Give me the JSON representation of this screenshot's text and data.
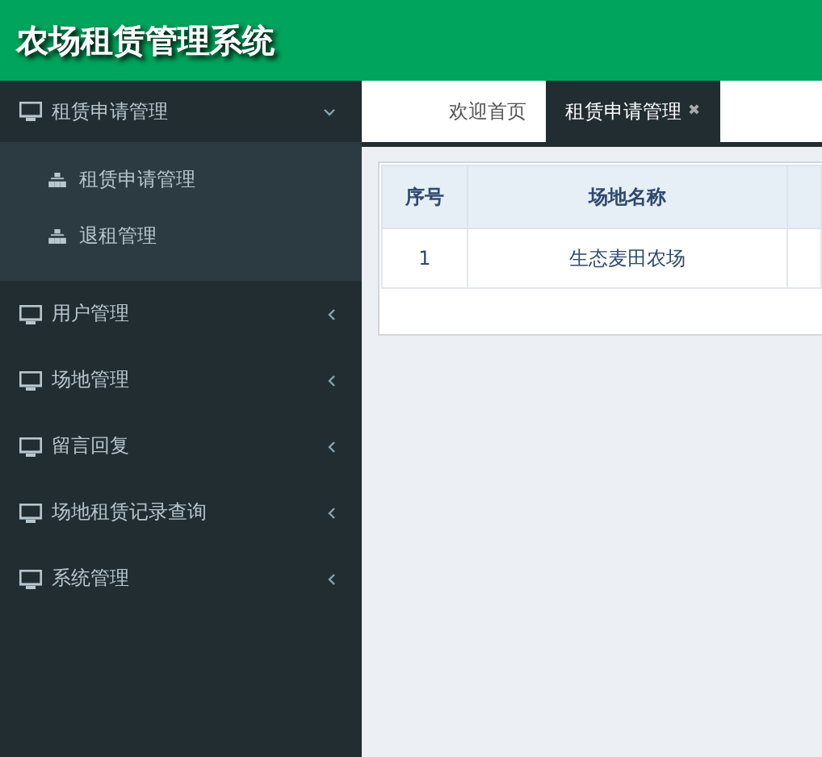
{
  "app_title": "农场租赁管理系统",
  "sidebar": {
    "items": [
      {
        "label": "租赁申请管理",
        "expanded": true,
        "children": [
          {
            "label": "租赁申请管理"
          },
          {
            "label": "退租管理"
          }
        ]
      },
      {
        "label": "用户管理",
        "expanded": false
      },
      {
        "label": "场地管理",
        "expanded": false
      },
      {
        "label": "留言回复",
        "expanded": false
      },
      {
        "label": "场地租赁记录查询",
        "expanded": false
      },
      {
        "label": "系统管理",
        "expanded": false
      }
    ]
  },
  "tabs": [
    {
      "label": "欢迎首页",
      "selected": false,
      "closable": false
    },
    {
      "label": "租赁申请管理",
      "selected": true,
      "closable": true
    }
  ],
  "close_glyph": "✖",
  "table": {
    "columns": [
      "序号",
      "场地名称"
    ],
    "rows": [
      [
        "1",
        "生态麦田农场"
      ]
    ]
  }
}
